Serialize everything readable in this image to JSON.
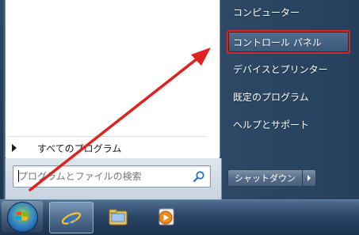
{
  "start_menu": {
    "all_programs_label": "すべてのプログラム",
    "search": {
      "placeholder": "プログラムとファイルの検索",
      "value": ""
    },
    "right_items": [
      {
        "label": "コンピューター"
      },
      {
        "label": "コントロール パネル"
      },
      {
        "label": "デバイスとプリンター"
      },
      {
        "label": "既定のプログラム"
      },
      {
        "label": "ヘルプとサポート"
      }
    ],
    "shutdown_label": "シャットダウン"
  },
  "taskbar": {
    "items": [
      {
        "icon": "windows-start-orb"
      },
      {
        "icon": "internet-explorer-icon"
      },
      {
        "icon": "windows-explorer-icon"
      },
      {
        "icon": "media-player-icon"
      }
    ]
  },
  "colors": {
    "highlight_border": "#d22a2a",
    "annotation_arrow": "#e0221f"
  }
}
